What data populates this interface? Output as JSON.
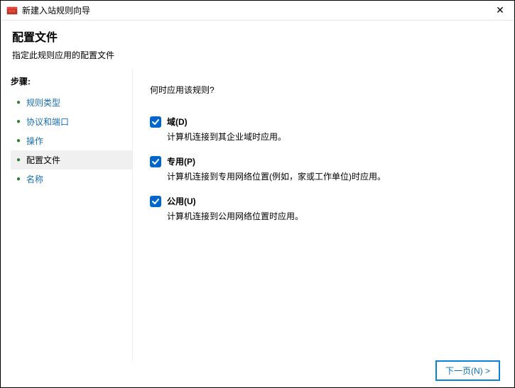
{
  "titlebar": {
    "title": "新建入站规则向导"
  },
  "header": {
    "title": "配置文件",
    "subtitle": "指定此规则应用的配置文件"
  },
  "sidebar": {
    "heading": "步骤:",
    "steps": [
      {
        "label": "规则类型",
        "current": false
      },
      {
        "label": "协议和端口",
        "current": false
      },
      {
        "label": "操作",
        "current": false
      },
      {
        "label": "配置文件",
        "current": true
      },
      {
        "label": "名称",
        "current": false
      }
    ]
  },
  "content": {
    "question": "何时应用该规则?",
    "profiles": [
      {
        "label": "域(D)",
        "desc": "计算机连接到其企业域时应用。",
        "checked": true
      },
      {
        "label": "专用(P)",
        "desc": "计算机连接到专用网络位置(例如，家或工作单位)时应用。",
        "checked": true
      },
      {
        "label": "公用(U)",
        "desc": "计算机连接到公用网络位置时应用。",
        "checked": true
      }
    ]
  },
  "footer": {
    "next": "下一页(N) >"
  }
}
